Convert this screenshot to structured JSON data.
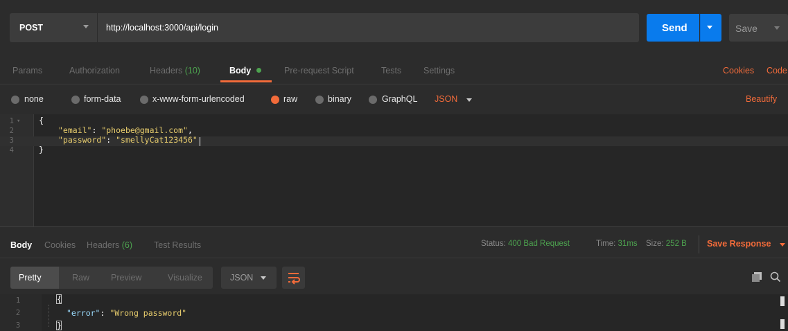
{
  "request": {
    "method": "POST",
    "url": "http://localhost:3000/api/login",
    "send_label": "Send",
    "save_label": "Save"
  },
  "request_tabs": {
    "params": "Params",
    "authorization": "Authorization",
    "headers": "Headers",
    "headers_count": "(10)",
    "body": "Body",
    "pre_request": "Pre-request Script",
    "tests": "Tests",
    "settings": "Settings",
    "cookies": "Cookies",
    "code": "Code",
    "active": "Body"
  },
  "body_types": {
    "none": "none",
    "form_data": "form-data",
    "urlencoded": "x-www-form-urlencoded",
    "raw": "raw",
    "binary": "binary",
    "graphql": "GraphQL",
    "selected": "raw",
    "format": "JSON",
    "beautify": "Beautify"
  },
  "request_body": {
    "line_numbers": [
      "1",
      "2",
      "3",
      "4"
    ],
    "open_brace": "{",
    "close_brace": "}",
    "email_key": "\"email\"",
    "email_value": "\"phoebe@gmail.com\"",
    "password_key": "\"password\"",
    "password_value": "\"smellyCat123456\""
  },
  "response_tabs": {
    "body": "Body",
    "cookies": "Cookies",
    "headers": "Headers",
    "headers_count": "(6)",
    "test_results": "Test Results",
    "active": "Body"
  },
  "status": {
    "status_label": "Status:",
    "status_value": "400 Bad Request",
    "time_label": "Time:",
    "time_value": "31ms",
    "size_label": "Size:",
    "size_value": "252 B",
    "save_response": "Save Response"
  },
  "response_view": {
    "pretty": "Pretty",
    "raw": "Raw",
    "preview": "Preview",
    "visualize": "Visualize",
    "active": "Pretty",
    "format": "JSON"
  },
  "response_body": {
    "line_numbers": [
      "1",
      "2",
      "3"
    ],
    "open_brace": "{",
    "close_brace": "}",
    "error_key": "\"error\"",
    "error_value": "\"Wrong password\""
  },
  "colors": {
    "accent": "#f26b3a",
    "send": "#097bed",
    "success": "#4da34f",
    "background": "#2c2c2c"
  },
  "icons": [
    "chevron-down-icon",
    "wrap-lines-icon",
    "copy-icon",
    "search-icon",
    "fold-arrow-icon"
  ]
}
